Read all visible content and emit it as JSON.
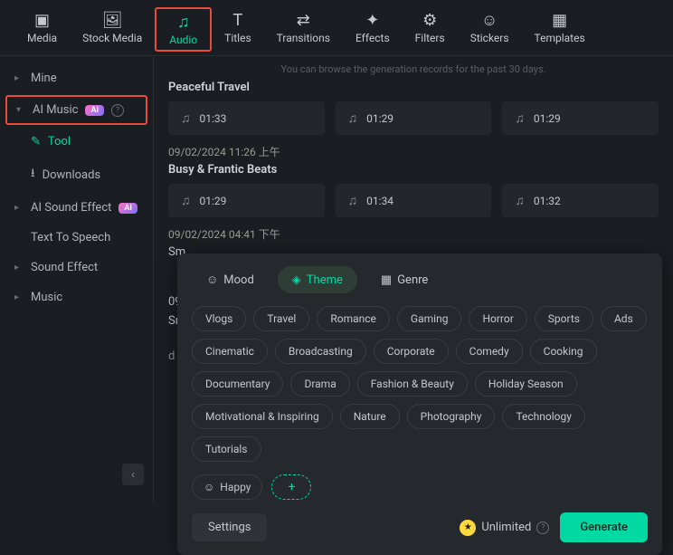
{
  "topNav": {
    "media": "Media",
    "stockMedia": "Stock Media",
    "audio": "Audio",
    "titles": "Titles",
    "transitions": "Transitions",
    "effects": "Effects",
    "filters": "Filters",
    "stickers": "Stickers",
    "templates": "Templates"
  },
  "sidebar": {
    "mine": "Mine",
    "aiMusic": "AI Music",
    "aiBadge": "AI",
    "tool": "Tool",
    "downloads": "Downloads",
    "aiSoundEffect": "AI Sound Effect",
    "textToSpeech": "Text To Speech",
    "soundEffect": "Sound Effect",
    "music": "Music"
  },
  "content": {
    "hint": "You can browse the generation records for the past 30 days.",
    "sections": [
      {
        "title": "Peaceful Travel",
        "tracks": [
          "01:33",
          "01:29",
          "01:29"
        ]
      },
      {
        "time": "09/02/2024 11:26 上午",
        "title": "Busy & Frantic Beats",
        "tracks": [
          "01:29",
          "01:34",
          "01:32"
        ]
      },
      {
        "time": "09/02/2024 04:41 下午",
        "title": "Sm",
        "tracks": []
      }
    ],
    "partialTime": "09/",
    "partialTitle": "Sm",
    "partialD": "d"
  },
  "panel": {
    "tabs": {
      "mood": "Mood",
      "theme": "Theme",
      "genre": "Genre"
    },
    "chips": [
      "Vlogs",
      "Travel",
      "Romance",
      "Gaming",
      "Horror",
      "Sports",
      "Ads",
      "Cinematic",
      "Broadcasting",
      "Corporate",
      "Comedy",
      "Cooking",
      "Documentary",
      "Drama",
      "Fashion & Beauty",
      "Holiday Season",
      "Motivational & Inspiring",
      "Nature",
      "Photography",
      "Technology",
      "Tutorials"
    ],
    "selectedMood": "Happy",
    "settings": "Settings",
    "unlimited": "Unlimited",
    "generate": "Generate"
  }
}
